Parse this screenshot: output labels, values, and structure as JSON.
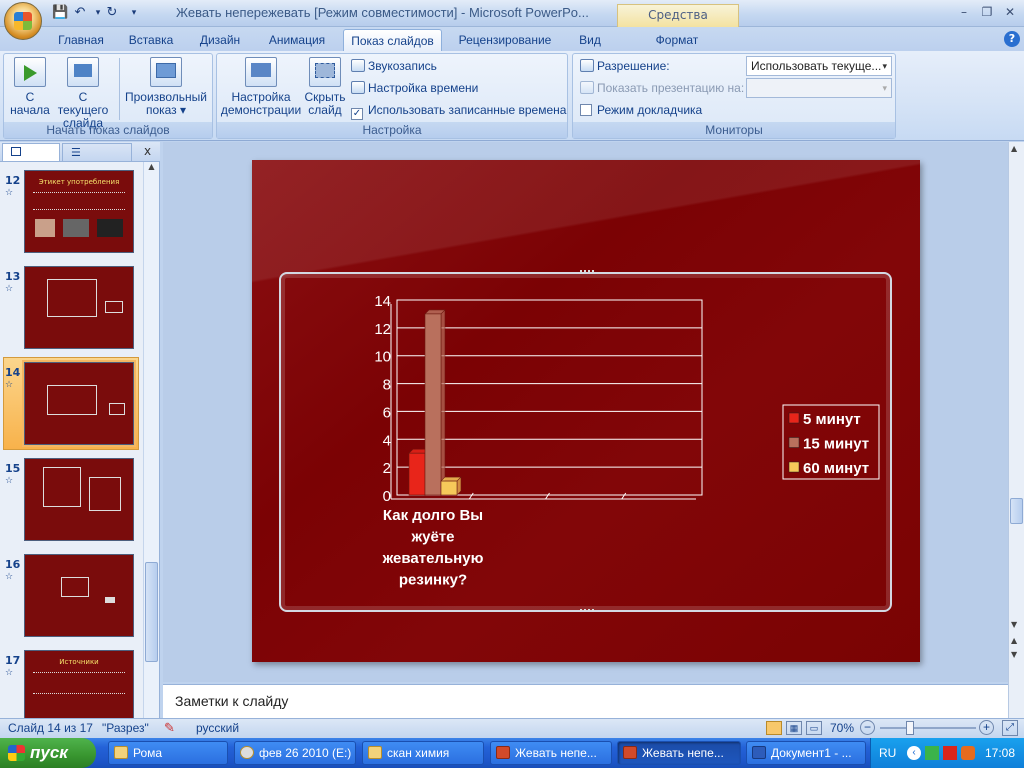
{
  "window": {
    "title": "Жевать непережевать [Режим совместимости] - Microsoft PowerPo...",
    "contextual_tab": "Средства рисования"
  },
  "tabs": [
    "Главная",
    "Вставка",
    "Дизайн",
    "Анимация",
    "Показ слайдов",
    "Рецензирование",
    "Вид",
    "Формат"
  ],
  "active_tab": "Показ слайдов",
  "ribbon": {
    "start_group": {
      "label": "Начать показ слайдов",
      "from_start_1": "С",
      "from_start_2": "начала",
      "from_current_1": "С текущего",
      "from_current_2": "слайда",
      "custom_1": "Произвольный",
      "custom_2": "показ ▾"
    },
    "setup_group": {
      "label": "Настройка",
      "setup_1": "Настройка",
      "setup_2": "демонстрации",
      "hide_1": "Скрыть",
      "hide_2": "слайд",
      "record_narration": "Звукозапись",
      "rehearse": "Настройка времени",
      "use_timings": "Использовать записанные времена",
      "use_timings_checked": "✓"
    },
    "monitors_group": {
      "label": "Мониторы",
      "resolution_label": "Разрешение:",
      "resolution_value": "Использовать текуще...",
      "show_on_label": "Показать презентацию на:",
      "show_on_value": "",
      "presenter_view": "Режим докладчика"
    }
  },
  "slides": [
    {
      "num": "12",
      "title": "Этикет употребления"
    },
    {
      "num": "13",
      "title": ""
    },
    {
      "num": "14",
      "title": ""
    },
    {
      "num": "15",
      "title": ""
    },
    {
      "num": "16",
      "title": ""
    },
    {
      "num": "17",
      "title": "Источники"
    }
  ],
  "chart_data": {
    "type": "bar",
    "title": "",
    "categories": [
      "Как долго Вы жуёте жевательную резинку?"
    ],
    "category_lines": [
      "Как долго Вы",
      "жуёте",
      "жевательную",
      "резинку?"
    ],
    "series": [
      {
        "name": "5 минут",
        "values": [
          3
        ],
        "color": "#e8251a"
      },
      {
        "name": "15 минут",
        "values": [
          13
        ],
        "color": "#b9705d"
      },
      {
        "name": "60 минут",
        "values": [
          1
        ],
        "color": "#f6c95a"
      }
    ],
    "ylim": [
      0,
      14
    ],
    "yticks": [
      "0",
      "2",
      "4",
      "6",
      "8",
      "10",
      "12",
      "14"
    ],
    "legend_position": "right",
    "grid": true
  },
  "notes": {
    "placeholder": "Заметки к слайду"
  },
  "status": {
    "slide_counter": "Слайд 14 из 17",
    "theme": "\"Разрез\"",
    "language": "русский",
    "zoom": "70%"
  },
  "taskbar": {
    "start": "пуск",
    "items": [
      "Рома",
      "фев 26 2010 (E:)",
      "скан химия",
      "Жевать непе...",
      "Жевать непе...",
      "Документ1 - ..."
    ],
    "lang": "RU",
    "clock": "17:08"
  },
  "colors": {
    "slide_bg": "#7b0204",
    "accent": "#15428b"
  }
}
